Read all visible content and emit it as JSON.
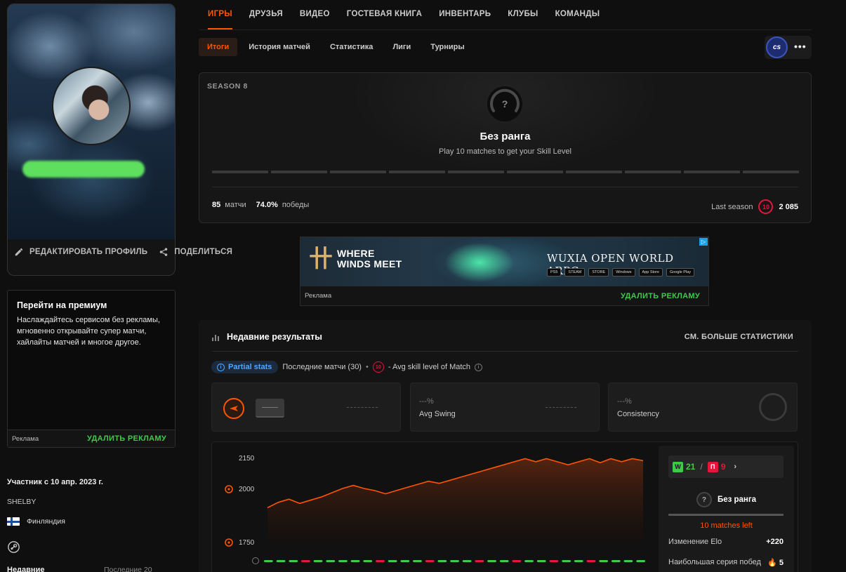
{
  "nav": {
    "tabs": [
      "ИГРЫ",
      "ДРУЗЬЯ",
      "ВИДЕО",
      "ГОСТЕВАЯ КНИГА",
      "ИНВЕНТАРЬ",
      "КЛУБЫ",
      "КОМАНДЫ"
    ],
    "active_tab": "ИГРЫ"
  },
  "subnav": {
    "tabs": [
      "Итоги",
      "История матчей",
      "Статистика",
      "Лиги",
      "Турниры"
    ],
    "active_tab": "Итоги"
  },
  "game_switch": {
    "game_label": "cs",
    "more": "•••"
  },
  "profile": {
    "edit_label": "РЕДАКТИРОВАТЬ ПРОФИЛЬ",
    "share_label": "ПОДЕЛИТЬСЯ"
  },
  "premium": {
    "title": "Перейти на премиум",
    "text": "Наслаждайтесь сервисом без рекламы, мгновенно открывайте супер матчи, хайлайты матчей и многое другое.",
    "ad_label": "Реклама",
    "remove_ads": "УДАЛИТЬ РЕКЛАМУ"
  },
  "info": {
    "member_since": "Участник с 10 апр. 2023 г.",
    "nickname": "SHELBY",
    "country": "Финляндия",
    "cut_left": "Недавние",
    "cut_right": "Последние 20"
  },
  "season": {
    "label": "SEASON 8",
    "rank_symbol": "?",
    "rank_title": "Без ранга",
    "rank_subtitle": "Play 10 matches to get your Skill Level",
    "level_segments": 10,
    "matches_value": "85",
    "matches_label": "матчи",
    "winrate_value": "74.0%",
    "winrate_label": "победы",
    "last_season_label": "Last season",
    "last_season_level": "10",
    "last_season_elo": "2 085"
  },
  "ad": {
    "logo_glyph": "卄",
    "logo_line1": "WHERE",
    "logo_line2": "WINDS MEET",
    "headline": "WUXIA OPEN WORLD ARPG",
    "platforms": [
      "PS5",
      "STEAM",
      "STORE",
      "Windows",
      "App Store",
      "Google Play"
    ],
    "corner": "▷",
    "ad_label": "Реклама",
    "remove_ads": "УДАЛИТЬ РЕКЛАМУ"
  },
  "recent": {
    "title": "Недавние результаты",
    "see_more": "СМ. БОЛЬШЕ СТАТИСТИКИ",
    "partial_stats": "Partial stats",
    "last_matches": "Последние матчи (30)",
    "separator": "•",
    "level_badge": "10",
    "avg_skill": "- Avg skill level of Match",
    "avg_swing_value": "---%",
    "avg_swing_label": "Avg Swing",
    "consistency_value": "---%",
    "consistency_label": "Consistency"
  },
  "side": {
    "wins": "21",
    "losses": "9",
    "win_tag": "W",
    "loss_tag": "П",
    "slash": "/",
    "chevron": "›",
    "rank_symbol": "?",
    "rank": "Без ранга",
    "matches_left": "10 matches left",
    "elo_change_label": "Изменение Elo",
    "elo_change_value": "+220",
    "streak_label": "Наибольшая серия побед",
    "streak_value": "5"
  },
  "colors": {
    "accent": "#ff5500",
    "win": "#3fca49",
    "loss": "#e5163c",
    "info_blue": "#52a7ff"
  },
  "chart_data": {
    "type": "area",
    "y_ticks": [
      2150,
      2000,
      1750
    ],
    "ylim": [
      1750,
      2150
    ],
    "elo": [
      1910,
      1935,
      1950,
      1930,
      1945,
      1960,
      1980,
      2000,
      2015,
      2000,
      1990,
      1975,
      1990,
      2005,
      2020,
      2035,
      2025,
      2040,
      2055,
      2070,
      2085,
      2100,
      2115,
      2130,
      2145,
      2130,
      2145,
      2130,
      2115,
      2130,
      2145,
      2125,
      2145,
      2130,
      2145,
      2135
    ],
    "results": [
      "W",
      "W",
      "W",
      "L",
      "W",
      "W",
      "W",
      "W",
      "W",
      "L",
      "W",
      "W",
      "W",
      "L",
      "W",
      "W",
      "W",
      "L",
      "W",
      "W",
      "L",
      "W",
      "W",
      "L",
      "W",
      "W",
      "L",
      "W",
      "W",
      "W",
      "W"
    ]
  }
}
